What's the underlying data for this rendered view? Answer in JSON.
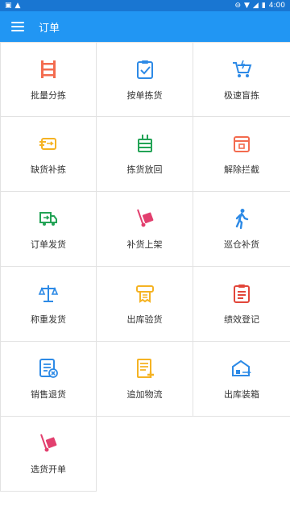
{
  "status_bar": {
    "time": "4:00"
  },
  "app_bar": {
    "title": "订单"
  },
  "tiles": [
    {
      "label": "批量分拣",
      "icon": "shelf-icon",
      "color": "#f36b4f"
    },
    {
      "label": "按单拣货",
      "icon": "clipboard-check-icon",
      "color": "#2d8ae6"
    },
    {
      "label": "极速盲拣",
      "icon": "fast-cart-icon",
      "color": "#2d8ae6"
    },
    {
      "label": "缺货补拣",
      "icon": "box-swap-icon",
      "color": "#f5b323"
    },
    {
      "label": "拣货放回",
      "icon": "return-box-icon",
      "color": "#23a356"
    },
    {
      "label": "解除拦截",
      "icon": "unlock-box-icon",
      "color": "#f36b4f"
    },
    {
      "label": "订单发货",
      "icon": "delivery-truck-icon",
      "color": "#23a356"
    },
    {
      "label": "补货上架",
      "icon": "hand-truck-icon",
      "color": "#e23f6e"
    },
    {
      "label": "巡仓补货",
      "icon": "walking-person-icon",
      "color": "#2d8ae6"
    },
    {
      "label": "称重发货",
      "icon": "scale-icon",
      "color": "#2d8ae6"
    },
    {
      "label": "出库验货",
      "icon": "receipt-printer-icon",
      "color": "#f5b323"
    },
    {
      "label": "绩效登记",
      "icon": "clipboard-list-icon",
      "color": "#e2463a"
    },
    {
      "label": "销售退货",
      "icon": "document-cancel-icon",
      "color": "#2d8ae6"
    },
    {
      "label": "追加物流",
      "icon": "document-add-icon",
      "color": "#f5b323"
    },
    {
      "label": "出库装箱",
      "icon": "warehouse-ship-icon",
      "color": "#2d8ae6"
    },
    {
      "label": "选货开单",
      "icon": "hand-truck-icon",
      "color": "#e23f6e"
    }
  ]
}
